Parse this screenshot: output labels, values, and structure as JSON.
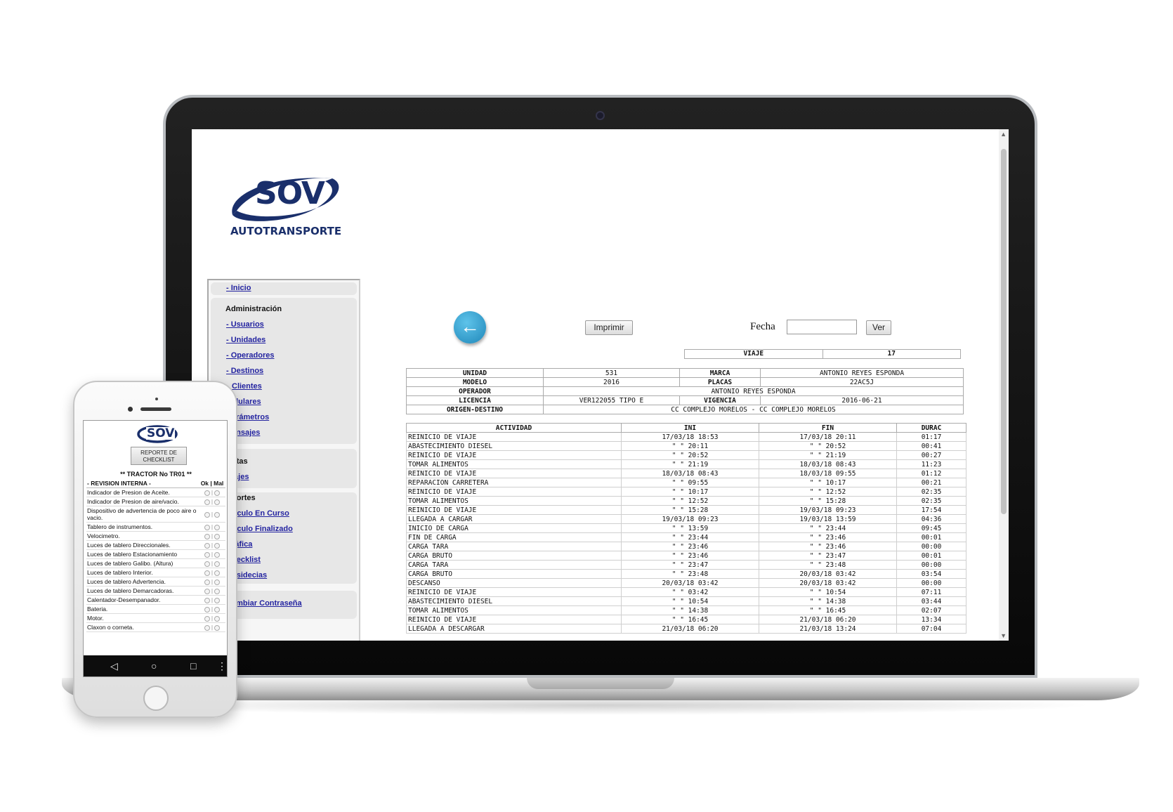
{
  "brand": {
    "name": "SOV",
    "subtitle": "AUTOTRANSPORTE"
  },
  "sidebar": {
    "home": "- Inicio",
    "admin_head": "Administración",
    "admin_links": [
      "- Usuarios",
      "- Unidades",
      "- Operadores",
      "- Destinos",
      "Clientes",
      "elulares",
      "arámetros",
      "ensajes"
    ],
    "ventas_head": "ntas",
    "ventas_links": [
      "iajes"
    ],
    "reportes_head": "portes",
    "reportes_links": [
      "írculo En Curso",
      "írculo Finalizado",
      "ráfica",
      "hecklist",
      "nsidecias"
    ],
    "password_link": "ambiar Contraseña"
  },
  "toolbar": {
    "print_label": "Imprimir",
    "date_label": "Fecha",
    "date_value": "",
    "view_label": "Ver"
  },
  "trip": {
    "label": "VIAJE",
    "value": "17"
  },
  "info": {
    "unidad_label": "UNIDAD",
    "unidad": "531",
    "marca_label": "MARCA",
    "marca": "ANTONIO REYES ESPONDA",
    "modelo_label": "MODELO",
    "modelo": "2016",
    "placas_label": "PLACAS",
    "placas": "22AC5J",
    "operador_label": "OPERADOR",
    "operador": "ANTONIO REYES ESPONDA",
    "licencia_label": "LICENCIA",
    "licencia": "VER122055 TIPO E",
    "vigencia_label": "VIGENCIA",
    "vigencia": "2016-06-21",
    "ruta_label": "ORIGEN-DESTINO",
    "ruta": "CC COMPLEJO MORELOS - CC COMPLEJO MORELOS"
  },
  "activities": {
    "headers": [
      "ACTIVIDAD",
      "INI",
      "FIN",
      "DURAC"
    ],
    "rows": [
      [
        "REINICIO DE VIAJE",
        "17/03/18 18:53",
        "17/03/18 20:11",
        "01:17"
      ],
      [
        "ABASTECIMIENTO DIESEL",
        "\" \"  20:11",
        "\" \"  20:52",
        "00:41"
      ],
      [
        "REINICIO DE VIAJE",
        "\" \"  20:52",
        "\" \"  21:19",
        "00:27"
      ],
      [
        "TOMAR ALIMENTOS",
        "\" \"  21:19",
        "18/03/18 08:43",
        "11:23"
      ],
      [
        "REINICIO DE VIAJE",
        "18/03/18 08:43",
        "18/03/18 09:55",
        "01:12"
      ],
      [
        "REPARACION CARRETERA",
        "\" \"  09:55",
        "\" \"  10:17",
        "00:21"
      ],
      [
        "REINICIO DE VIAJE",
        "\" \"  10:17",
        "\" \"  12:52",
        "02:35"
      ],
      [
        "TOMAR ALIMENTOS",
        "\" \"  12:52",
        "\" \"  15:28",
        "02:35"
      ],
      [
        "REINICIO DE VIAJE",
        "\" \"  15:28",
        "19/03/18 09:23",
        "17:54"
      ],
      [
        "LLEGADA A CARGAR",
        "19/03/18 09:23",
        "19/03/18 13:59",
        "04:36"
      ],
      [
        "INICIO DE CARGA",
        "\" \"  13:59",
        "\" \"  23:44",
        "09:45"
      ],
      [
        "FIN DE CARGA",
        "\" \"  23:44",
        "\" \"  23:46",
        "00:01"
      ],
      [
        "CARGA TARA",
        "\" \"  23:46",
        "\" \"  23:46",
        "00:00"
      ],
      [
        "CARGA BRUTO",
        "\" \"  23:46",
        "\" \"  23:47",
        "00:01"
      ],
      [
        "CARGA TARA",
        "\" \"  23:47",
        "\" \"  23:48",
        "00:00"
      ],
      [
        "CARGA BRUTO",
        "\" \"  23:48",
        "20/03/18 03:42",
        "03:54"
      ],
      [
        "DESCANSO",
        "20/03/18 03:42",
        "20/03/18 03:42",
        "00:00"
      ],
      [
        "REINICIO DE VIAJE",
        "\" \"  03:42",
        "\" \"  10:54",
        "07:11"
      ],
      [
        "ABASTECIMIENTO DIESEL",
        "\" \"  10:54",
        "\" \"  14:38",
        "03:44"
      ],
      [
        "TOMAR ALIMENTOS",
        "\" \"  14:38",
        "\" \"  16:45",
        "02:07"
      ],
      [
        "REINICIO DE VIAJE",
        "\" \"  16:45",
        "21/03/18 06:20",
        "13:34"
      ],
      [
        "LLEGADA A DESCARGAR",
        "21/03/18 06:20",
        "21/03/18 13:24",
        "07:04"
      ]
    ]
  },
  "phone": {
    "brand": "SOV",
    "report_button": "REPORTE DE CHECKLIST",
    "title": "** TRACTOR No TR01 **",
    "section": "- REVISION INTERNA -",
    "cols": "Ok | Mal",
    "items": [
      "Indicador de Presion de Aceite.",
      "Indicador de Presion de aire/vacio.",
      "Dispositivo de advertencia de poco aire o vacio.",
      "Tablero de instrumentos.",
      "Velocimetro.",
      "Luces de tablero Direccionales.",
      "Luces de tablero Estacionamiento",
      "Luces de tablero Galibo. (Altura)",
      "Luces de tablero Interior.",
      "Luces de tablero Advertencia.",
      "Luces de tablero Demarcadoras.",
      "Calentador-Desempanador.",
      "Bateria.",
      "Motor.",
      "Claxon o corneta."
    ]
  }
}
